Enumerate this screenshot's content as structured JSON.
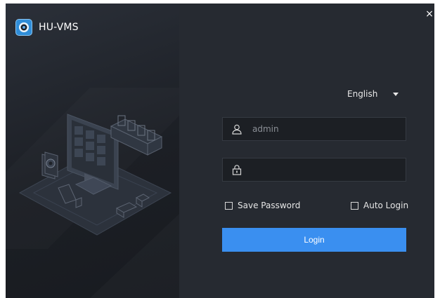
{
  "app": {
    "title": "HU-VMS"
  },
  "window": {
    "close_glyph": "×"
  },
  "language": {
    "selected": "English"
  },
  "username": {
    "placeholder": "admin",
    "value": ""
  },
  "password": {
    "placeholder": "",
    "value": ""
  },
  "options": {
    "save_password": "Save Password",
    "auto_login": "Auto Login"
  },
  "login": {
    "label": "Login"
  },
  "colors": {
    "accent": "#3a8ff0",
    "panel": "#262a31",
    "field": "#1c1f24"
  },
  "icons": [
    "camera-logo-icon",
    "close-icon",
    "chevron-down-icon",
    "user-icon",
    "lock-icon",
    "checkbox-icon"
  ]
}
